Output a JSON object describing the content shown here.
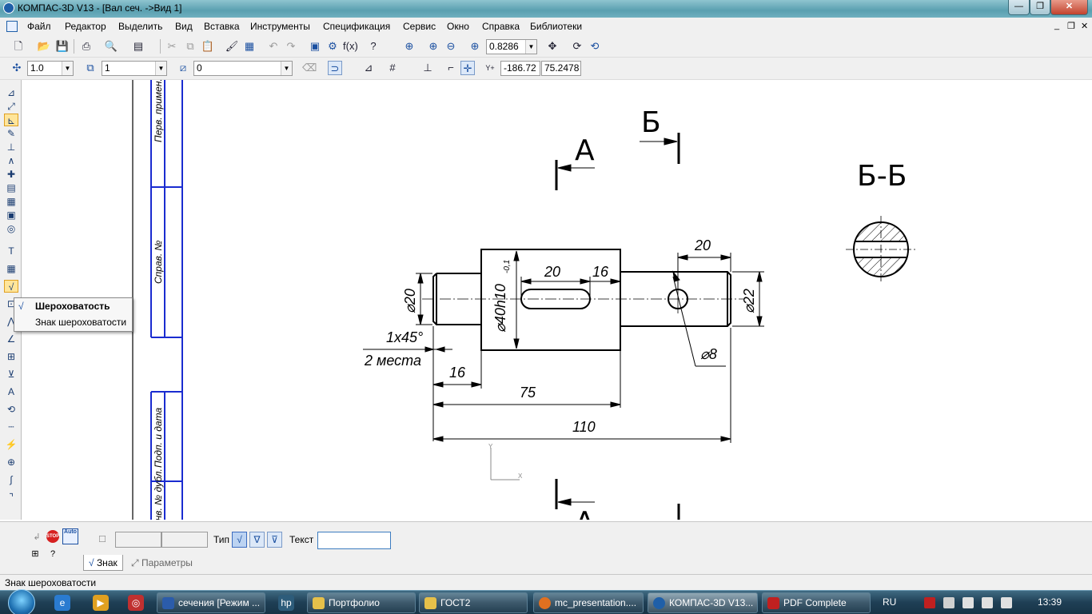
{
  "window": {
    "title": "КОМПАС-3D V13 - [Вал сеч. ->Вид 1]",
    "controls": [
      "—",
      "❐",
      "✕"
    ]
  },
  "menu": {
    "items": [
      "Файл",
      "Редактор",
      "Выделить",
      "Вид",
      "Вставка",
      "Инструменты",
      "Спецификация",
      "Сервис",
      "Окно",
      "Справка",
      "Библиотеки"
    ],
    "mdi_controls": [
      "_",
      "❐",
      "✕"
    ]
  },
  "toolbar_standard": {
    "zoom_value": "0.8286"
  },
  "toolbar_current_state": {
    "step_value": "1.0",
    "layer_value": "1",
    "style_value": "0",
    "coord_x": "-186.72",
    "coord_y": "75.2478"
  },
  "popup": {
    "title": "Шероховатость",
    "item": "Знак шероховатости"
  },
  "drawing": {
    "stamp_labels": [
      "Перв. примен.",
      "Справ. №",
      "Подп. и дата",
      "Инв. № дубл."
    ],
    "section_a_label": "А",
    "section_b_label": "Б",
    "section_view_title": "Б-Б",
    "dim_shaft_left_diam": "⌀20",
    "dim_shaft_mid_diam": "⌀40h10",
    "dim_shaft_mid_tol": "-0,1",
    "dim_shaft_right_diam": "⌀22",
    "dim_chamfer": "1x45°",
    "dim_chamfer_note": "2 места",
    "dim_slot_length": "20",
    "dim_slot_offset": "16",
    "dim_hole_offset": "20",
    "dim_hole_diam": "⌀8",
    "dim_left_step": "16",
    "dim_75": "75",
    "dim_110": "110",
    "axis_x": "X",
    "axis_y": "Y"
  },
  "property_bar": {
    "type_label": "Тип",
    "text_label": "Текст",
    "text_value": "",
    "tabs": [
      "Знак",
      "Параметры"
    ],
    "auto_label": "Auto",
    "stop_label": "STOP"
  },
  "status": {
    "text": "Знак шероховатости"
  },
  "taskbar": {
    "tasks": [
      "сечения [Режим ...",
      "Портфолио",
      "ГОСТ2",
      "mc_presentation....",
      "КОМПАС-3D V13...",
      "PDF Complete"
    ],
    "language": "RU",
    "clock": "13:39"
  }
}
